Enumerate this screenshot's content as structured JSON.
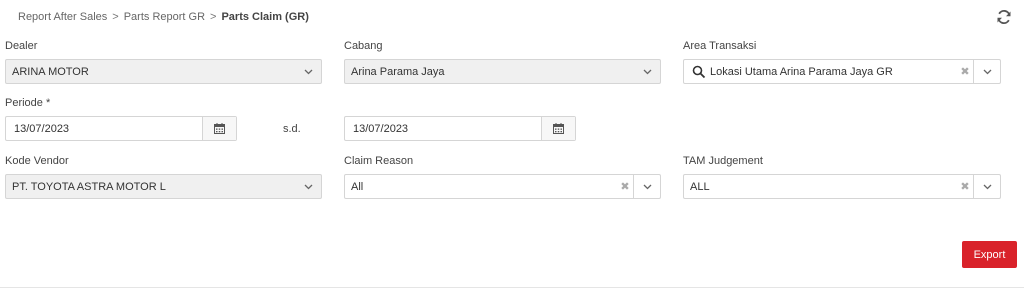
{
  "breadcrumb": {
    "items": [
      "Report After Sales",
      "Parts Report GR"
    ],
    "current": "Parts Claim (GR)"
  },
  "filters": {
    "dealer": {
      "label": "Dealer",
      "value": "ARINA MOTOR"
    },
    "cabang": {
      "label": "Cabang",
      "value": "Arina Parama Jaya"
    },
    "area_transaksi": {
      "label": "Area Transaksi",
      "value": "Lokasi Utama Arina Parama Jaya GR"
    },
    "periode": {
      "label": "Periode *",
      "from": "13/07/2023",
      "separator": "s.d.",
      "to": "13/07/2023"
    },
    "kode_vendor": {
      "label": "Kode Vendor",
      "value": "PT. TOYOTA ASTRA MOTOR L"
    },
    "claim_reason": {
      "label": "Claim Reason",
      "value": "All"
    },
    "tam_judgement": {
      "label": "TAM Judgement",
      "value": "ALL"
    }
  },
  "actions": {
    "export_label": "Export"
  },
  "colors": {
    "export_bg": "#d9222a",
    "disabled_bg": "#f0f0f0"
  },
  "icons": {
    "refresh": "refresh-icon",
    "calendar": "calendar-icon",
    "search": "search-icon",
    "chevron": "chevron-down-icon",
    "clear": "clear-icon"
  }
}
